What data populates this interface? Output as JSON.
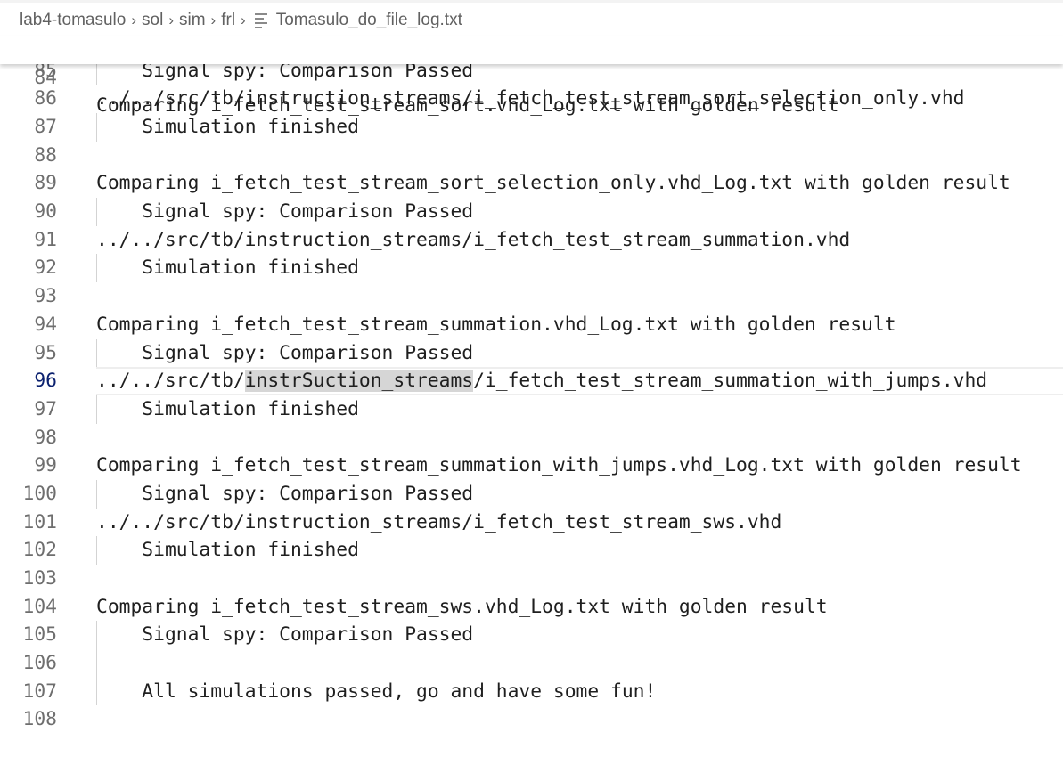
{
  "breadcrumb": {
    "items": [
      "lab4-tomasulo",
      "sol",
      "sim",
      "frl"
    ],
    "file": "Tomasulo_do_file_log.txt",
    "file_icon": "text-file-icon"
  },
  "sticky": {
    "number": "84",
    "text": "Comparing i_fetch_test_stream_sort.vhd_Log.txt with golden result"
  },
  "lines": [
    {
      "number": "85",
      "indent": true,
      "text": "Signal spy: Comparison Passed"
    },
    {
      "number": "86",
      "indent": false,
      "text": "../../src/tb/instruction_streams/i_fetch_test_stream_sort_selection_only.vhd"
    },
    {
      "number": "87",
      "indent": true,
      "text": "Simulation finished"
    },
    {
      "number": "88",
      "indent": false,
      "text": ""
    },
    {
      "number": "89",
      "indent": false,
      "text": "Comparing i_fetch_test_stream_sort_selection_only.vhd_Log.txt with golden result"
    },
    {
      "number": "90",
      "indent": true,
      "text": "Signal spy: Comparison Passed"
    },
    {
      "number": "91",
      "indent": false,
      "text": "../../src/tb/instruction_streams/i_fetch_test_stream_summation.vhd"
    },
    {
      "number": "92",
      "indent": true,
      "text": "Simulation finished"
    },
    {
      "number": "93",
      "indent": false,
      "text": ""
    },
    {
      "number": "94",
      "indent": false,
      "text": "Comparing i_fetch_test_stream_summation.vhd_Log.txt with golden result"
    },
    {
      "number": "95",
      "indent": true,
      "text": "Signal spy: Comparison Passed"
    },
    {
      "number": "96",
      "indent": false,
      "current": true,
      "pre": "../../src/tb/",
      "highlight": "instrSuction_streams",
      "post": "/i_fetch_test_stream_summation_with_jumps.vhd"
    },
    {
      "number": "97",
      "indent": true,
      "text": "Simulation finished"
    },
    {
      "number": "98",
      "indent": false,
      "text": ""
    },
    {
      "number": "99",
      "indent": false,
      "text": "Comparing i_fetch_test_stream_summation_with_jumps.vhd_Log.txt with golden result"
    },
    {
      "number": "100",
      "indent": true,
      "text": "Signal spy: Comparison Passed"
    },
    {
      "number": "101",
      "indent": false,
      "text": "../../src/tb/instruction_streams/i_fetch_test_stream_sws.vhd"
    },
    {
      "number": "102",
      "indent": true,
      "text": "Simulation finished"
    },
    {
      "number": "103",
      "indent": false,
      "text": ""
    },
    {
      "number": "104",
      "indent": false,
      "text": "Comparing i_fetch_test_stream_sws.vhd_Log.txt with golden result"
    },
    {
      "number": "105",
      "indent": true,
      "text": "Signal spy: Comparison Passed"
    },
    {
      "number": "106",
      "indent": true,
      "text": ""
    },
    {
      "number": "107",
      "indent": true,
      "text": "All simulations passed, go and have some fun!"
    },
    {
      "number": "108",
      "indent": false,
      "text": ""
    }
  ]
}
